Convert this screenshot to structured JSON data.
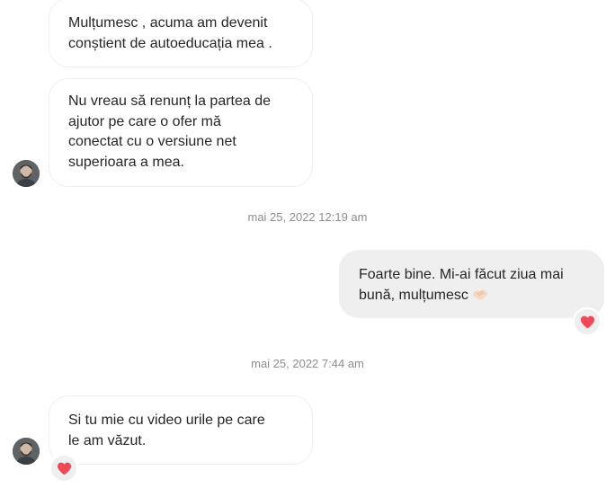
{
  "messages": [
    {
      "lines": [
        "Mulțumesc , acuma am devenit",
        "conștient de autoeducația mea ."
      ]
    },
    {
      "lines": [
        "Nu vreau să renunț la partea de",
        "ajutor pe care o ofer mă",
        "conectat cu o versiune net",
        "superioara a mea."
      ]
    },
    {
      "timestamp": "mai 25, 2022 12:19 am"
    },
    {
      "lines": [
        "Foarte bine. Mi-ai făcut ziua mai",
        "bună, mulțumesc"
      ],
      "emoji": "handshake-emoji",
      "reaction": "heart-icon"
    },
    {
      "timestamp": "mai 25, 2022 7:44 am"
    },
    {
      "lines": [
        "Si tu mie cu video urile pe care",
        "le am văzut."
      ],
      "reaction": "heart-icon"
    }
  ],
  "colors": {
    "heart": "#ed4956",
    "timestamp": "#8e8e8e",
    "outgoing_bubble": "#efefef",
    "incoming_border": "#efefef"
  }
}
